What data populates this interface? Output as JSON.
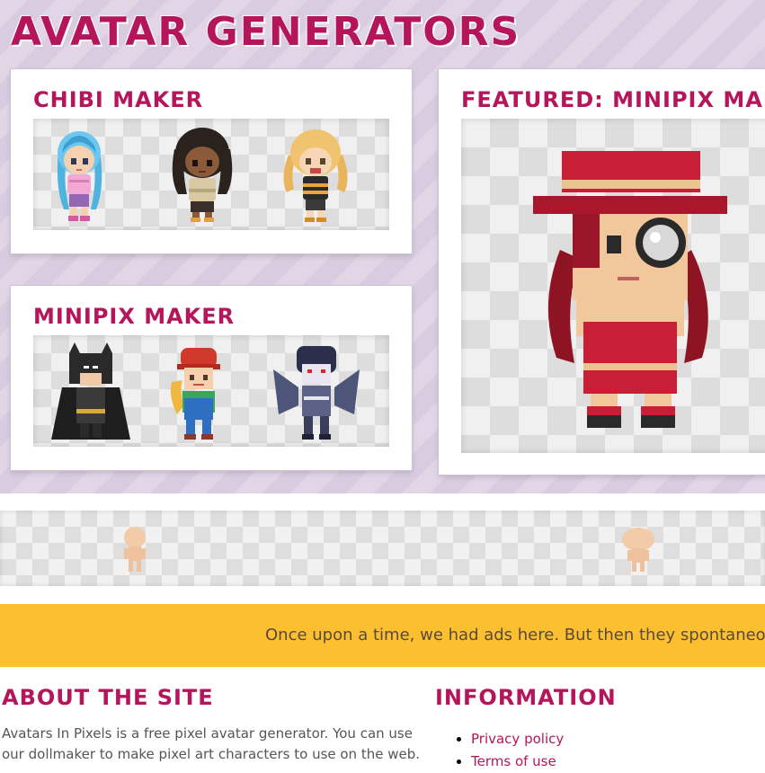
{
  "header": {
    "title": "Avatar Generators"
  },
  "cards": {
    "chibi": {
      "title": "Chibi Maker",
      "avatars": [
        "blue-hair-chibi-avatar",
        "dark-skin-chibi-avatar",
        "blonde-chibi-avatar"
      ]
    },
    "minipix": {
      "title": "Minipix Maker",
      "avatars": [
        "batman-minipix-avatar",
        "red-cap-minipix-avatar",
        "winged-minipix-avatar"
      ]
    },
    "featured": {
      "title": "Featured: Minipix Maker",
      "avatar": "red-hat-monocle-minipix-avatar"
    }
  },
  "strip": {
    "figures": [
      "base-figure-left",
      "base-figure-right"
    ]
  },
  "ad": {
    "text": "Once upon a time, we had ads here. But then they spontaneously gr"
  },
  "footer": {
    "about": {
      "title": "About the Site",
      "text": "Avatars In Pixels is a free pixel avatar generator. You can use our dollmaker to make pixel art characters to use on the web."
    },
    "information": {
      "title": "Information",
      "links": [
        "Privacy policy",
        "Terms of use"
      ]
    }
  },
  "colors": {
    "accent": "#b5155a",
    "ad_band": "#fbbf2f",
    "band_bg": "#ded2e4"
  }
}
